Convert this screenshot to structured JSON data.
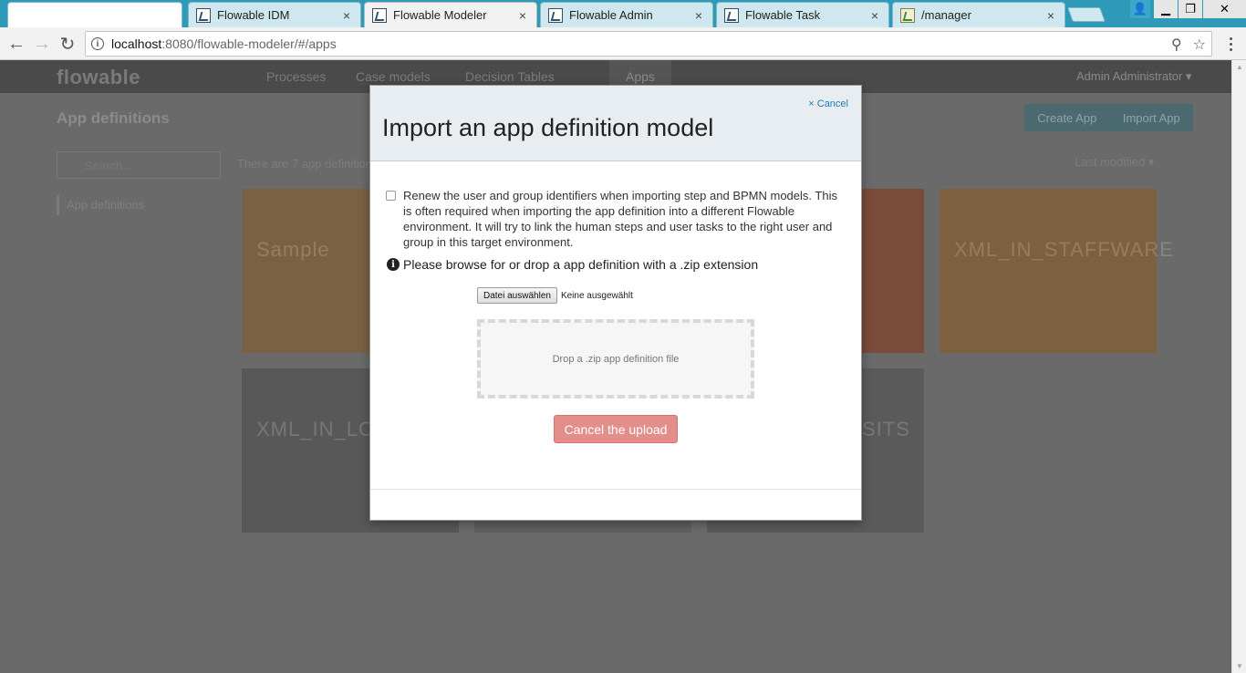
{
  "browser": {
    "tabs": [
      {
        "title": "",
        "kind": "blank"
      },
      {
        "title": "Flowable IDM",
        "kind": "flowable"
      },
      {
        "title": "Flowable Modeler",
        "kind": "flowable",
        "active": true
      },
      {
        "title": "Flowable Admin",
        "kind": "flowable"
      },
      {
        "title": "Flowable Task",
        "kind": "flowable"
      },
      {
        "title": "/manager",
        "kind": "image"
      }
    ],
    "close_glyph": "×",
    "url_host": "localhost",
    "url_rest": ":8080/flowable-modeler/#/apps",
    "info_glyph": "i",
    "back_glyph": "←",
    "forward_glyph": "→",
    "reload_glyph": "↻",
    "zoom_glyph": "⚲",
    "star_glyph": "☆",
    "window": {
      "user_glyph": "👤",
      "min_glyph": "▁",
      "max_glyph": "❐",
      "close_glyph": "✕"
    }
  },
  "background_app": {
    "logo": "flowable",
    "nav": [
      "Processes",
      "Case models",
      "Decision Tables",
      "Apps"
    ],
    "user": "Admin Administrator ▾",
    "page_title": "App definitions",
    "buttons": [
      "Create App",
      "Import App"
    ],
    "search_placeholder": "Search...",
    "count_text": "There are 7 app definitions",
    "sort_label": "Last modified ▾",
    "sidebar_item": "App definitions",
    "cards": [
      {
        "title": "Sample",
        "color": "#7a6144"
      },
      {
        "title": "",
        "color": "#7a4a3a"
      },
      {
        "title": "",
        "color": "#7a4a3a"
      },
      {
        "title": "XML_IN_STAFFWARE",
        "color": "#7c6040"
      },
      {
        "title": "XML_IN_LO",
        "color": "#585858"
      },
      {
        "title": "",
        "color": "#5f5f5f"
      },
      {
        "title": "SITS",
        "color": "#5a5a5a"
      }
    ]
  },
  "modal": {
    "cancel_link": "× Cancel",
    "title": "Import an app definition model",
    "renew_text": "Renew the user and group identifiers when importing step and BPMN models. This is often required when importing the app definition into a different Flowable environment. It will try to link the human steps and user tasks to the right user and group in this target environment.",
    "info_glyph": "i",
    "browse_text": "Please browse for or drop a app definition with a .zip extension",
    "file_button": "Datei auswählen",
    "file_status": "Keine ausgewählt",
    "dropzone_text": "Drop a .zip app definition file",
    "cancel_upload": "Cancel the upload"
  }
}
